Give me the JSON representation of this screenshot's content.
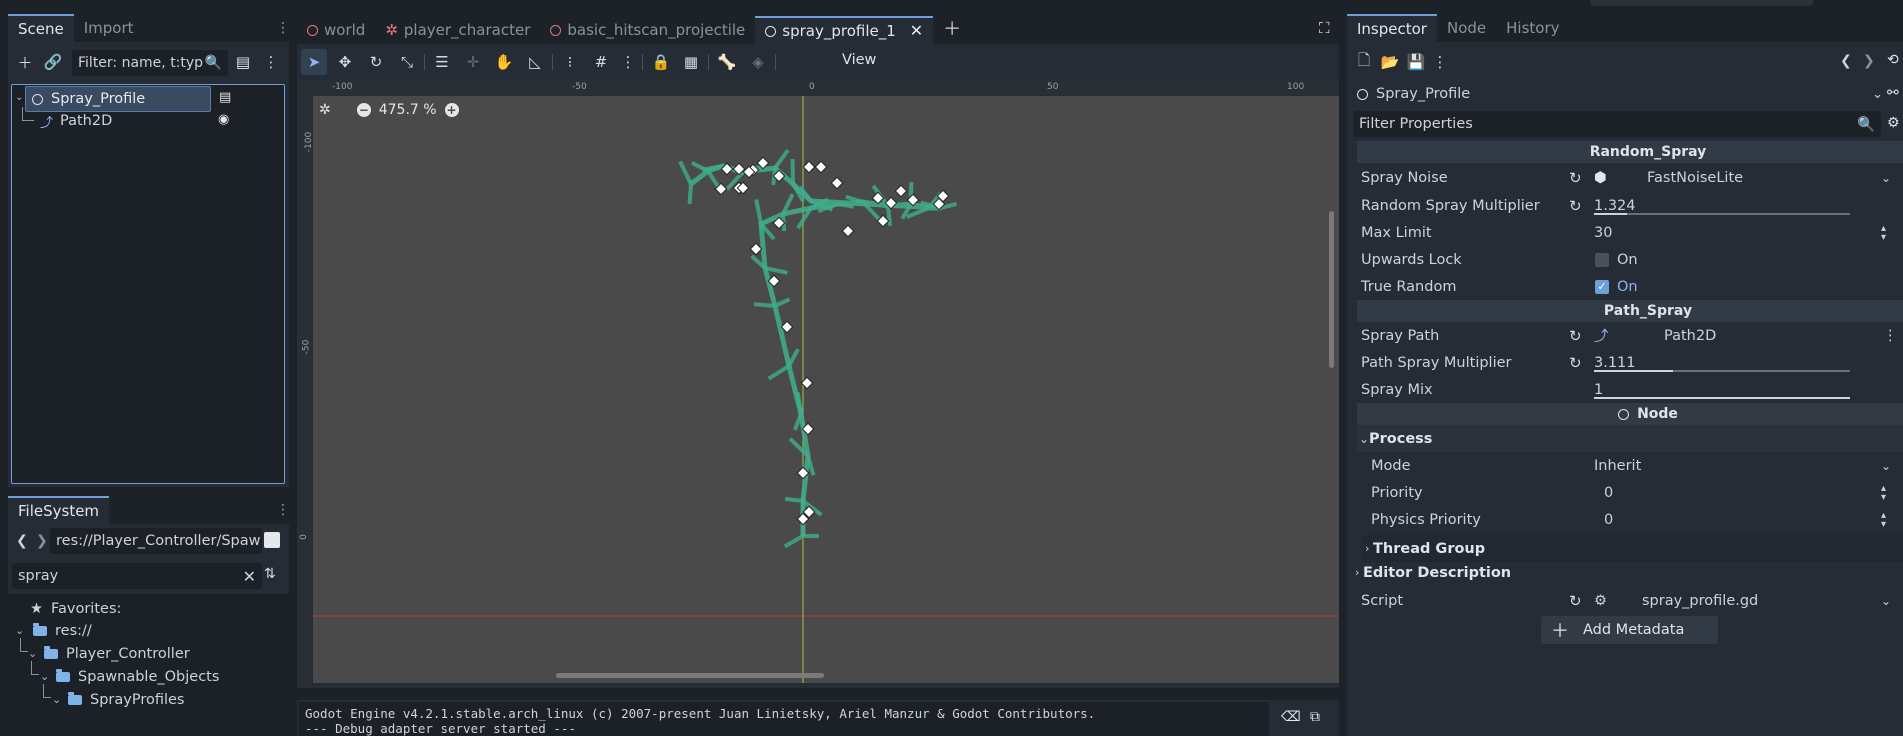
{
  "scene_panel": {
    "tabs": [
      "Scene",
      "Import"
    ],
    "filter_placeholder": "Filter: name, t:typ",
    "tree": [
      {
        "label": "Spray_Profile"
      },
      {
        "label": "Path2D"
      }
    ]
  },
  "filesystem": {
    "tab": "FileSystem",
    "path": "res://Player_Controller/Spaw",
    "search": "spray",
    "items": [
      {
        "label": "Favorites:"
      },
      {
        "label": "res://"
      },
      {
        "label": "Player_Controller"
      },
      {
        "label": "Spawnable_Objects"
      },
      {
        "label": "SprayProfiles"
      }
    ]
  },
  "editor_tabs": [
    "world",
    "player_character",
    "basic_hitscan_projectile",
    "spray_profile_1"
  ],
  "toolbar": {
    "view_label": "View"
  },
  "viewport": {
    "zoom": "475.7 %",
    "ruler_top": [
      "-100",
      "-50",
      "0",
      "50",
      "100"
    ],
    "ruler_left": [
      "-100",
      "-50",
      "0"
    ]
  },
  "output": {
    "lines": [
      "Godot Engine v4.2.1.stable.arch_linux (c) 2007-present Juan Linietsky, Ariel Manzur & Godot Contributors.",
      "--- Debug adapter server started ---"
    ]
  },
  "inspector": {
    "tabs": [
      "Inspector",
      "Node",
      "History"
    ],
    "object_name": "Spray_Profile",
    "filter_placeholder": "Filter Properties",
    "sections": {
      "random_spray": "Random_Spray",
      "path_spray": "Path_Spray",
      "node": "Node"
    },
    "props": {
      "spray_noise": {
        "label": "Spray Noise",
        "value": "FastNoiseLite"
      },
      "random_mult": {
        "label": "Random Spray Multiplier",
        "value": "1.324",
        "fraction": 0.13
      },
      "max_limit": {
        "label": "Max Limit",
        "value": "30"
      },
      "upwards_lock": {
        "label": "Upwards Lock",
        "value": "On",
        "checked": false
      },
      "true_random": {
        "label": "True Random",
        "value": "On",
        "checked": true
      },
      "spray_path": {
        "label": "Spray Path",
        "value": "Path2D"
      },
      "path_mult": {
        "label": "Path Spray Multiplier",
        "value": "3.111",
        "fraction": 0.31
      },
      "spray_mix": {
        "label": "Spray Mix",
        "value": "1",
        "fraction": 1.0
      },
      "process": {
        "label": "Process"
      },
      "mode": {
        "label": "Mode",
        "value": "Inherit"
      },
      "priority": {
        "label": "Priority",
        "value": "0"
      },
      "physics_priority": {
        "label": "Physics Priority",
        "value": "0"
      },
      "thread_group": {
        "label": "Thread Group"
      },
      "editor_description": {
        "label": "Editor Description"
      },
      "script": {
        "label": "Script",
        "value": "spray_profile.gd"
      }
    },
    "add_metadata": "Add Metadata"
  },
  "colors": {
    "accent": "#6e9fd6",
    "spray": "#3fae8c",
    "canvas": "#4a4a4a",
    "x_axis": "#b33b3b",
    "y_axis": "#a6c34a"
  }
}
